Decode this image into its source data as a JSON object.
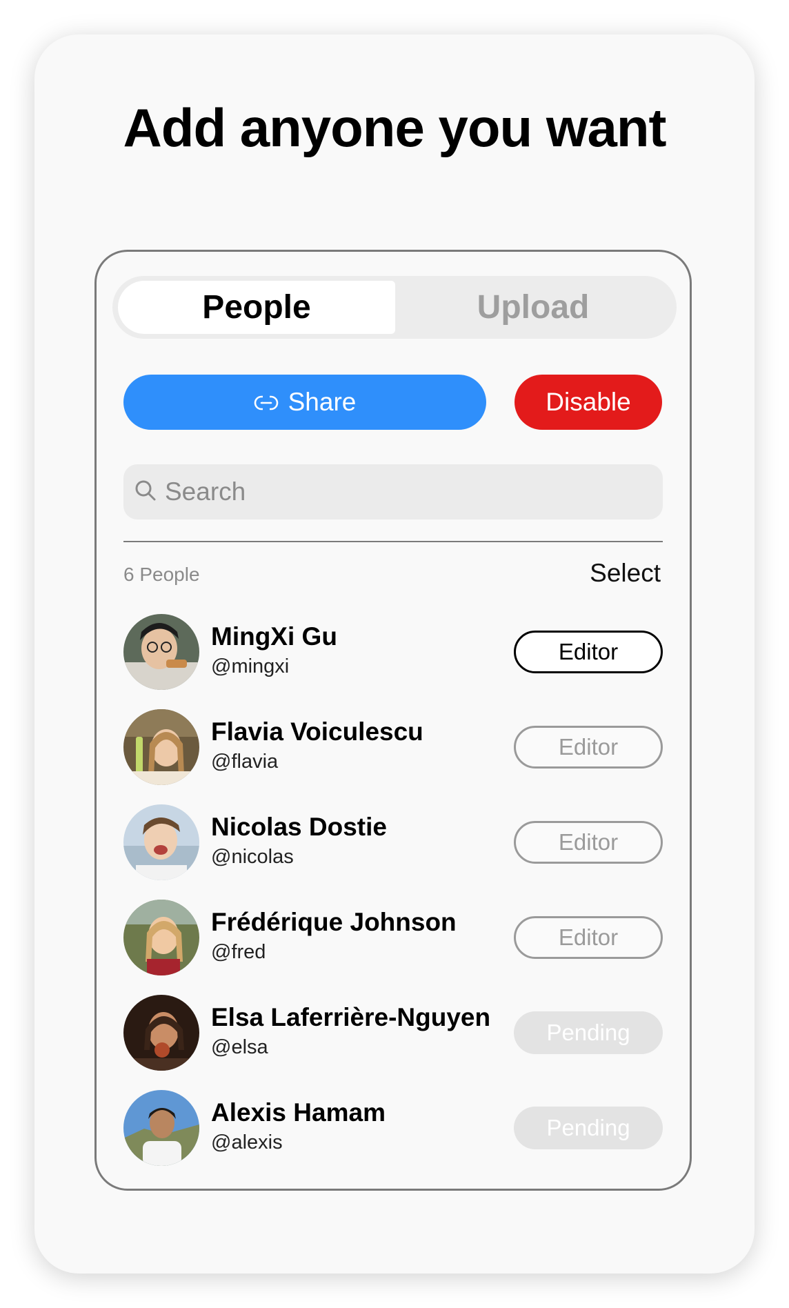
{
  "headline": "Add anyone you want",
  "tabs": [
    {
      "label": "People",
      "active": true
    },
    {
      "label": "Upload",
      "active": false
    }
  ],
  "actions": {
    "share_label": "Share",
    "disable_label": "Disable",
    "share_color": "#2f8ffb",
    "disable_color": "#e31b1b"
  },
  "search": {
    "placeholder": "Search",
    "value": ""
  },
  "list": {
    "count_label": "6 People",
    "select_label": "Select"
  },
  "people": [
    {
      "name": "MingXi Gu",
      "handle": "@mingxi",
      "role": "Editor",
      "role_state": "active"
    },
    {
      "name": "Flavia Voiculescu",
      "handle": "@flavia",
      "role": "Editor",
      "role_state": "dim"
    },
    {
      "name": "Nicolas Dostie",
      "handle": "@nicolas",
      "role": "Editor",
      "role_state": "dim"
    },
    {
      "name": "Frédérique Johnson",
      "handle": "@fred",
      "role": "Editor",
      "role_state": "dim"
    },
    {
      "name": "Elsa Laferrière-Nguyen",
      "handle": "@elsa",
      "role": "Pending",
      "role_state": "pending"
    },
    {
      "name": "Alexis Hamam",
      "handle": "@alexis",
      "role": "Pending",
      "role_state": "pending"
    }
  ]
}
